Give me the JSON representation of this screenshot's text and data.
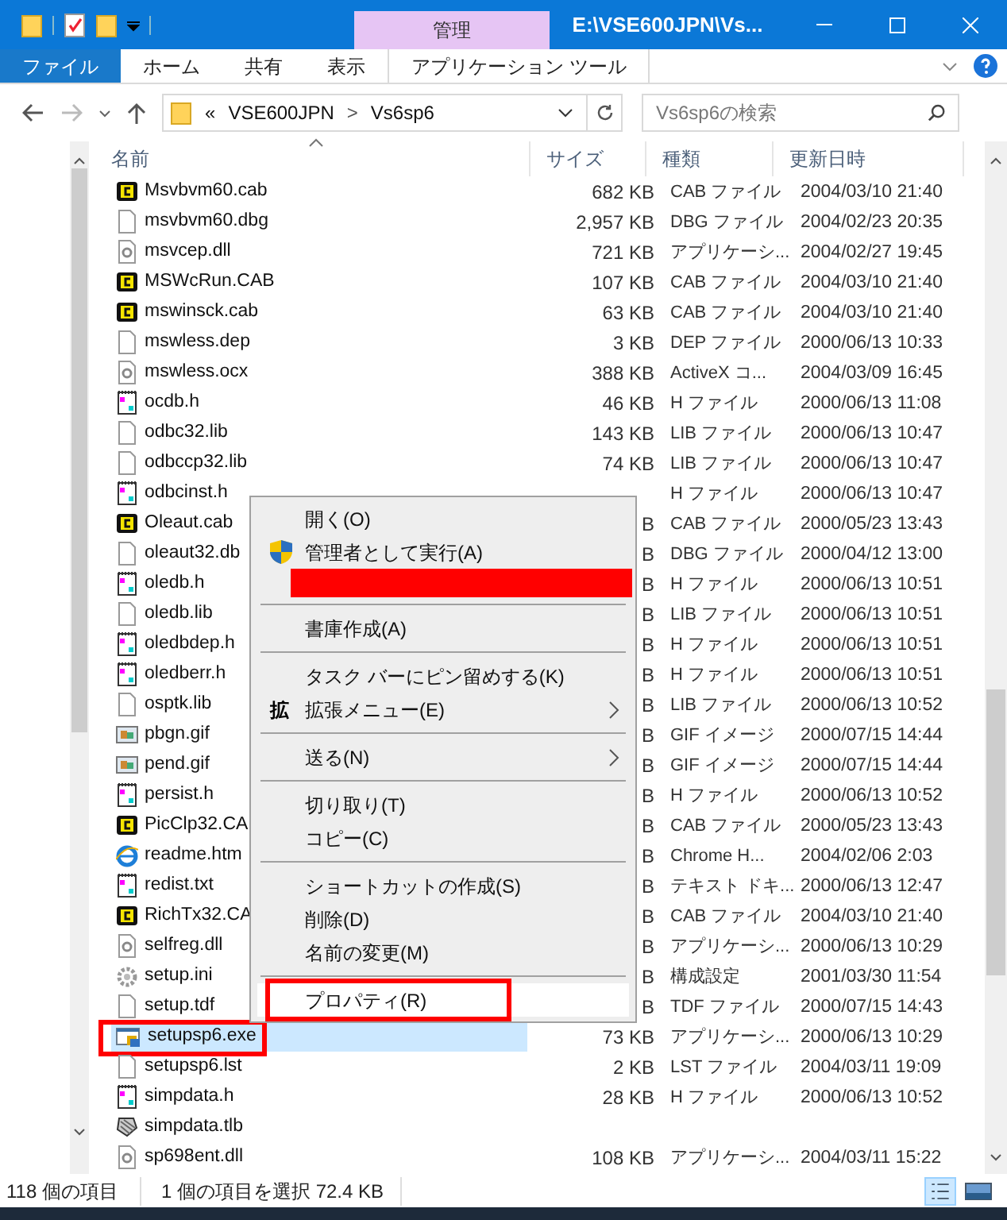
{
  "window": {
    "title": "E:\\VSE600JPN\\Vs...",
    "context_tab": "管理"
  },
  "ribbon_tabs": [
    {
      "label": "ファイル",
      "selected": true
    },
    {
      "label": "ホーム",
      "selected": false
    },
    {
      "label": "共有",
      "selected": false
    },
    {
      "label": "表示",
      "selected": false
    },
    {
      "label": "アプリケーション ツール",
      "selected": false
    }
  ],
  "address": {
    "prefix": "«",
    "segments": [
      "VSE600JPN",
      "Vs6sp6"
    ],
    "separator": ">"
  },
  "search": {
    "placeholder": "Vs6sp6の検索"
  },
  "columns": [
    "名前",
    "サイズ",
    "種類",
    "更新日時"
  ],
  "rows": [
    {
      "kind": "cab",
      "name": "Msvbvm60.cab",
      "size": "682 KB",
      "type": "CAB ファイル",
      "date": "2004/03/10 21:40",
      "selected": false
    },
    {
      "kind": "blank",
      "name": "msvbvm60.dbg",
      "size": "2,957 KB",
      "type": "DBG ファイル",
      "date": "2004/02/23 20:35",
      "selected": false
    },
    {
      "kind": "dll",
      "name": "msvcep.dll",
      "size": "721 KB",
      "type": "アプリケーシ...",
      "date": "2004/02/27 19:45",
      "selected": false
    },
    {
      "kind": "cab",
      "name": "MSWcRun.CAB",
      "size": "107 KB",
      "type": "CAB ファイル",
      "date": "2004/03/10 21:40",
      "selected": false
    },
    {
      "kind": "cab",
      "name": "mswinsck.cab",
      "size": "63 KB",
      "type": "CAB ファイル",
      "date": "2004/03/10 21:40",
      "selected": false
    },
    {
      "kind": "blank",
      "name": "mswless.dep",
      "size": "3 KB",
      "type": "DEP ファイル",
      "date": "2000/06/13 10:33",
      "selected": false
    },
    {
      "kind": "dll",
      "name": "mswless.ocx",
      "size": "388 KB",
      "type": "ActiveX コ...",
      "date": "2004/03/09 16:45",
      "selected": false
    },
    {
      "kind": "h",
      "name": "ocdb.h",
      "size": "46 KB",
      "type": "H ファイル",
      "date": "2000/06/13 11:08",
      "selected": false
    },
    {
      "kind": "blank",
      "name": "odbc32.lib",
      "size": "143 KB",
      "type": "LIB ファイル",
      "date": "2000/06/13 10:47",
      "selected": false
    },
    {
      "kind": "blank",
      "name": "odbccp32.lib",
      "size": "74 KB",
      "type": "LIB ファイル",
      "date": "2000/06/13 10:47",
      "selected": false
    },
    {
      "kind": "h",
      "name": "odbcinst.h",
      "type": "H ファイル",
      "date": "2000/06/13 10:47",
      "selected": false
    },
    {
      "kind": "cab",
      "name": "Oleaut.cab",
      "size": "B",
      "type": "CAB ファイル",
      "date": "2000/05/23 13:43",
      "selected": false
    },
    {
      "kind": "blank",
      "name": "oleaut32.db",
      "size": "B",
      "type": "DBG ファイル",
      "date": "2000/04/12 13:00",
      "selected": false
    },
    {
      "kind": "h",
      "name": "oledb.h",
      "size": "B",
      "type": "H ファイル",
      "date": "2000/06/13 10:51",
      "selected": false
    },
    {
      "kind": "blank",
      "name": "oledb.lib",
      "size": "B",
      "type": "LIB ファイル",
      "date": "2000/06/13 10:51",
      "selected": false
    },
    {
      "kind": "h",
      "name": "oledbdep.h",
      "size": "B",
      "type": "H ファイル",
      "date": "2000/06/13 10:51",
      "selected": false
    },
    {
      "kind": "h",
      "name": "oledberr.h",
      "size": "B",
      "type": "H ファイル",
      "date": "2000/06/13 10:51",
      "selected": false
    },
    {
      "kind": "blank",
      "name": "osptk.lib",
      "size": "B",
      "type": "LIB ファイル",
      "date": "2000/06/13 10:52",
      "selected": false
    },
    {
      "kind": "gif",
      "name": "pbgn.gif",
      "size": "B",
      "type": "GIF イメージ",
      "date": "2000/07/15 14:44",
      "selected": false
    },
    {
      "kind": "gif",
      "name": "pend.gif",
      "size": "B",
      "type": "GIF イメージ",
      "date": "2000/07/15 14:44",
      "selected": false
    },
    {
      "kind": "h",
      "name": "persist.h",
      "size": "B",
      "type": "H ファイル",
      "date": "2000/06/13 10:52",
      "selected": false
    },
    {
      "kind": "cab",
      "name": "PicClp32.CA",
      "size": "B",
      "type": "CAB ファイル",
      "date": "2000/05/23 13:43",
      "selected": false
    },
    {
      "kind": "htm",
      "name": "readme.htm",
      "size": "B",
      "type": "Chrome H...",
      "date": "2004/02/06 2:03",
      "selected": false
    },
    {
      "kind": "h",
      "name": "redist.txt",
      "size": "B",
      "type": "テキスト ドキ...",
      "date": "2000/06/13 12:47",
      "selected": false
    },
    {
      "kind": "cab",
      "name": "RichTx32.CA",
      "size": "B",
      "type": "CAB ファイル",
      "date": "2004/03/10 21:40",
      "selected": false
    },
    {
      "kind": "dll",
      "name": "selfreg.dll",
      "size": "B",
      "type": "アプリケーシ...",
      "date": "2000/06/13 10:29",
      "selected": false
    },
    {
      "kind": "ini",
      "name": "setup.ini",
      "size": "B",
      "type": "構成設定",
      "date": "2001/03/30 11:54",
      "selected": false
    },
    {
      "kind": "blank",
      "name": "setup.tdf",
      "size": "B",
      "type": "TDF ファイル",
      "date": "2000/07/15 14:43",
      "selected": false
    },
    {
      "kind": "exe",
      "name": "setupsp6.exe",
      "size": "73 KB",
      "type": "アプリケーシ...",
      "date": "2000/06/13 10:29",
      "selected": true,
      "annotated": true
    },
    {
      "kind": "blank",
      "name": "setupsp6.lst",
      "size": "2 KB",
      "type": "LST ファイル",
      "date": "2004/03/11 19:09",
      "selected": false
    },
    {
      "kind": "h",
      "name": "simpdata.h",
      "size": "28 KB",
      "type": "H ファイル",
      "date": "2000/06/13 10:52",
      "selected": false
    },
    {
      "kind": "tlb",
      "name": "simpdata.tlb",
      "selected": false
    },
    {
      "kind": "dll",
      "name": "sp698ent.dll",
      "size": "108 KB",
      "type": "アプリケーシ...",
      "date": "2004/03/11 15:22",
      "selected": false
    }
  ],
  "context_menu": [
    {
      "kind": "item",
      "label": "開く(O)",
      "hovered": false
    },
    {
      "kind": "shield_item",
      "label": "管理者として実行(A)",
      "hovered": false
    },
    {
      "kind": "redacted"
    },
    {
      "kind": "separator"
    },
    {
      "kind": "item",
      "label": "書庫作成(A)",
      "hovered": false
    },
    {
      "kind": "separator"
    },
    {
      "kind": "item",
      "label": "タスク バーにピン留めする(K)",
      "hovered": false
    },
    {
      "kind": "item",
      "label": "拡張メニュー(E)",
      "glyph": "拡",
      "submenu": true,
      "hovered": false
    },
    {
      "kind": "separator"
    },
    {
      "kind": "item",
      "label": "送る(N)",
      "submenu": true,
      "hovered": false
    },
    {
      "kind": "separator"
    },
    {
      "kind": "item",
      "label": "切り取り(T)",
      "hovered": false
    },
    {
      "kind": "item",
      "label": "コピー(C)",
      "hovered": false
    },
    {
      "kind": "separator"
    },
    {
      "kind": "item",
      "label": "ショートカットの作成(S)",
      "hovered": false
    },
    {
      "kind": "item",
      "label": "削除(D)",
      "hovered": false
    },
    {
      "kind": "item",
      "label": "名前の変更(M)",
      "hovered": false
    },
    {
      "kind": "separator"
    },
    {
      "kind": "item",
      "label": "プロパティ(R)",
      "hovered": true,
      "annotated": true
    }
  ],
  "status_bar": {
    "count": "118 個の項目",
    "selection": "1 個の項目を選択",
    "selection_size": "72.4 KB"
  }
}
